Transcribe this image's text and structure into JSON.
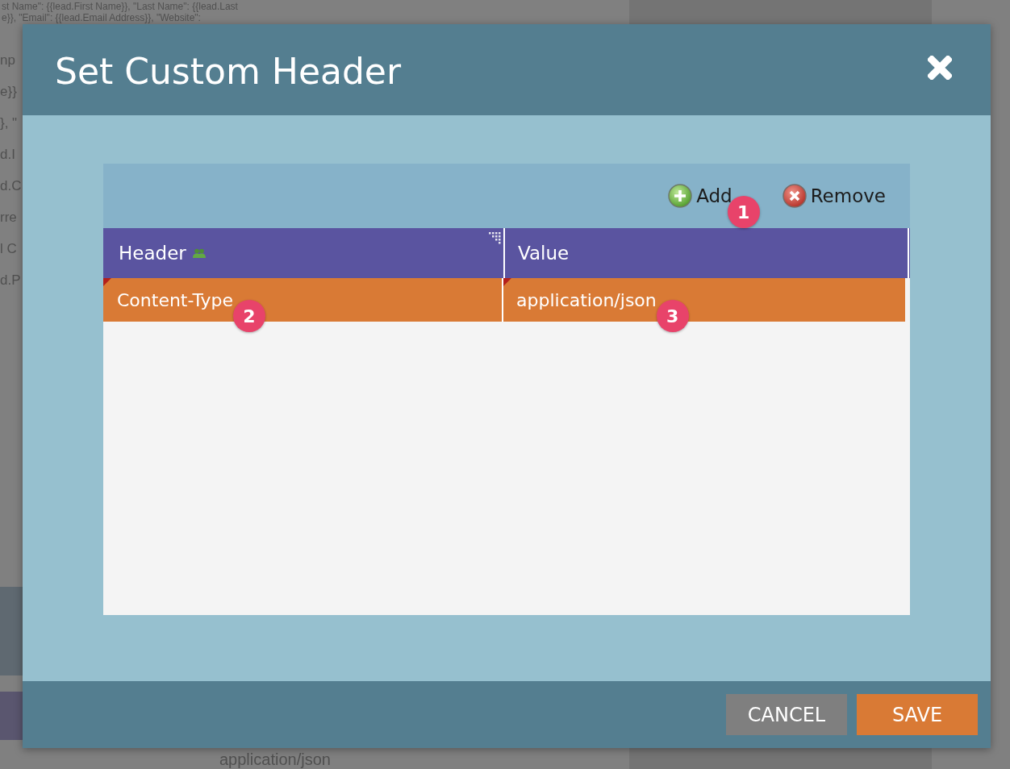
{
  "background": {
    "code_lines": [
      "st Name\": {{lead.First Name}}, \"Last Name\": {{lead.Last",
      "e}}, \"Email\": {{lead.Email Address}}, \"Website\":"
    ],
    "side_fragments": [
      "np",
      "e}}",
      "}, \"",
      "d.I",
      "d.C",
      "rre",
      "l C",
      "d.P"
    ],
    "lower_text": "application/json"
  },
  "dialog": {
    "title": "Set Custom Header",
    "toolbar": [
      {
        "kind": "add",
        "label": "Add",
        "callout": "1"
      },
      {
        "kind": "remove",
        "label": "Remove"
      }
    ],
    "grid": {
      "columns": [
        {
          "label": "Header",
          "icon": true,
          "resize_grip": true
        },
        {
          "label": "Value",
          "icon": false,
          "resize_grip": false
        }
      ],
      "rows": [
        {
          "selected": true,
          "cells": [
            {
              "text": "Content-Type",
              "modified": true,
              "callout": "2"
            },
            {
              "text": "application/json",
              "modified": true,
              "callout": "3"
            }
          ]
        }
      ]
    },
    "buttons": [
      {
        "kind": "secondary",
        "label": "CANCEL"
      },
      {
        "kind": "primary",
        "label": "SAVE"
      }
    ]
  }
}
